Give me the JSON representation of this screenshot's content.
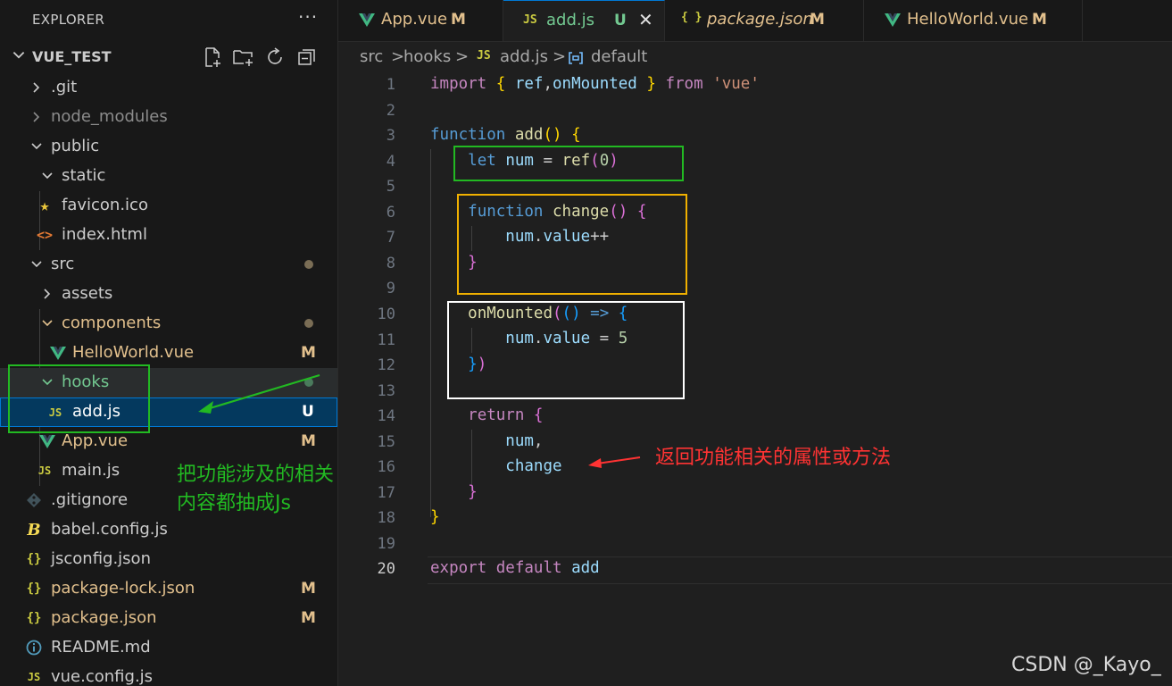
{
  "explorer": {
    "title": "EXPLORER",
    "more_label": "···",
    "project_name": "VUE_TEST",
    "actions": [
      "new-file-icon",
      "new-folder-icon",
      "refresh-icon",
      "collapse-all-icon"
    ]
  },
  "tree": [
    {
      "label": ".git",
      "icon": "",
      "chevron": "right",
      "badge": "",
      "dot": false
    },
    {
      "label": "node_modules",
      "icon": "",
      "chevron": "right",
      "badge": "",
      "dot": false
    },
    {
      "label": "public",
      "icon": "",
      "chevron": "down",
      "badge": "",
      "dot": false
    },
    {
      "label": "static",
      "icon": "",
      "chevron": "down",
      "badge": "",
      "dot": false
    },
    {
      "label": "favicon.ico",
      "icon": "star-icon",
      "chevron": "",
      "badge": "",
      "dot": false
    },
    {
      "label": "index.html",
      "icon": "html-icon",
      "chevron": "",
      "badge": "",
      "dot": false
    },
    {
      "label": "src",
      "icon": "",
      "chevron": "down",
      "badge": "",
      "dot": true
    },
    {
      "label": "assets",
      "icon": "",
      "chevron": "right",
      "badge": "",
      "dot": false
    },
    {
      "label": "components",
      "icon": "",
      "chevron": "down",
      "badge": "",
      "dot": true
    },
    {
      "label": "HelloWorld.vue",
      "icon": "vue-icon",
      "chevron": "",
      "badge": "M",
      "dot": false
    },
    {
      "label": "hooks",
      "icon": "",
      "chevron": "down",
      "badge": "",
      "dot": true
    },
    {
      "label": "add.js",
      "icon": "js-icon",
      "chevron": "",
      "badge": "U",
      "dot": false
    },
    {
      "label": "App.vue",
      "icon": "vue-icon",
      "chevron": "",
      "badge": "M",
      "dot": false
    },
    {
      "label": "main.js",
      "icon": "js-icon",
      "chevron": "",
      "badge": "",
      "dot": false
    },
    {
      "label": ".gitignore",
      "icon": "git-icon",
      "chevron": "",
      "badge": "",
      "dot": false
    },
    {
      "label": "babel.config.js",
      "icon": "babel-icon",
      "chevron": "",
      "badge": "",
      "dot": false
    },
    {
      "label": "jsconfig.json",
      "icon": "json-icon",
      "chevron": "",
      "badge": "",
      "dot": false
    },
    {
      "label": "package-lock.json",
      "icon": "json-icon",
      "chevron": "",
      "badge": "M",
      "dot": false
    },
    {
      "label": "package.json",
      "icon": "json-icon",
      "chevron": "",
      "badge": "M",
      "dot": false
    },
    {
      "label": "README.md",
      "icon": "info-icon",
      "chevron": "",
      "badge": "",
      "dot": false
    },
    {
      "label": "vue.config.js",
      "icon": "js-icon",
      "chevron": "",
      "badge": "",
      "dot": false
    }
  ],
  "tabs": [
    {
      "label": "App.vue",
      "badge": "M",
      "icon": "vue-icon",
      "icon_text": "V"
    },
    {
      "label": "add.js",
      "badge": "U",
      "icon": "js-icon",
      "icon_text": "JS",
      "close": "✕"
    },
    {
      "label": "package.json",
      "badge": "M",
      "icon": "json-icon",
      "icon_text": "{ }"
    },
    {
      "label": "HelloWorld.vue",
      "badge": "M",
      "icon": "vue-icon",
      "icon_text": "V"
    }
  ],
  "breadcrumb": {
    "parts": [
      "src",
      "hooks",
      "add.js",
      "default"
    ],
    "separator": ">",
    "js_icon_text": "JS"
  },
  "code": {
    "current_line": 20,
    "lines": [
      "import { ref,onMounted } from 'vue'",
      "",
      "function add() {",
      "    let num = ref(0)",
      "",
      "    function change() {",
      "        num.value++",
      "    }",
      "",
      "    onMounted(() => {",
      "        num.value = 5",
      "    })",
      "",
      "    return {",
      "        num,",
      "        change",
      "    }",
      "}",
      "",
      "export default add"
    ]
  },
  "annotations": {
    "sidebar_note_line1": "把功能涉及的相关",
    "sidebar_note_line2": "内容都抽成Js",
    "code_note": "返回功能相关的属性或方法",
    "watermark": "CSDN @_Kayo_"
  },
  "colors": {
    "accent": "#0078d4",
    "vue_green": "#41b883",
    "js_yellow": "#cbcb41",
    "modified": "#e2c08d",
    "untracked": "#73c991",
    "anno_green": "#22b922",
    "anno_orange": "#f0b000",
    "anno_red": "#ff3333"
  }
}
